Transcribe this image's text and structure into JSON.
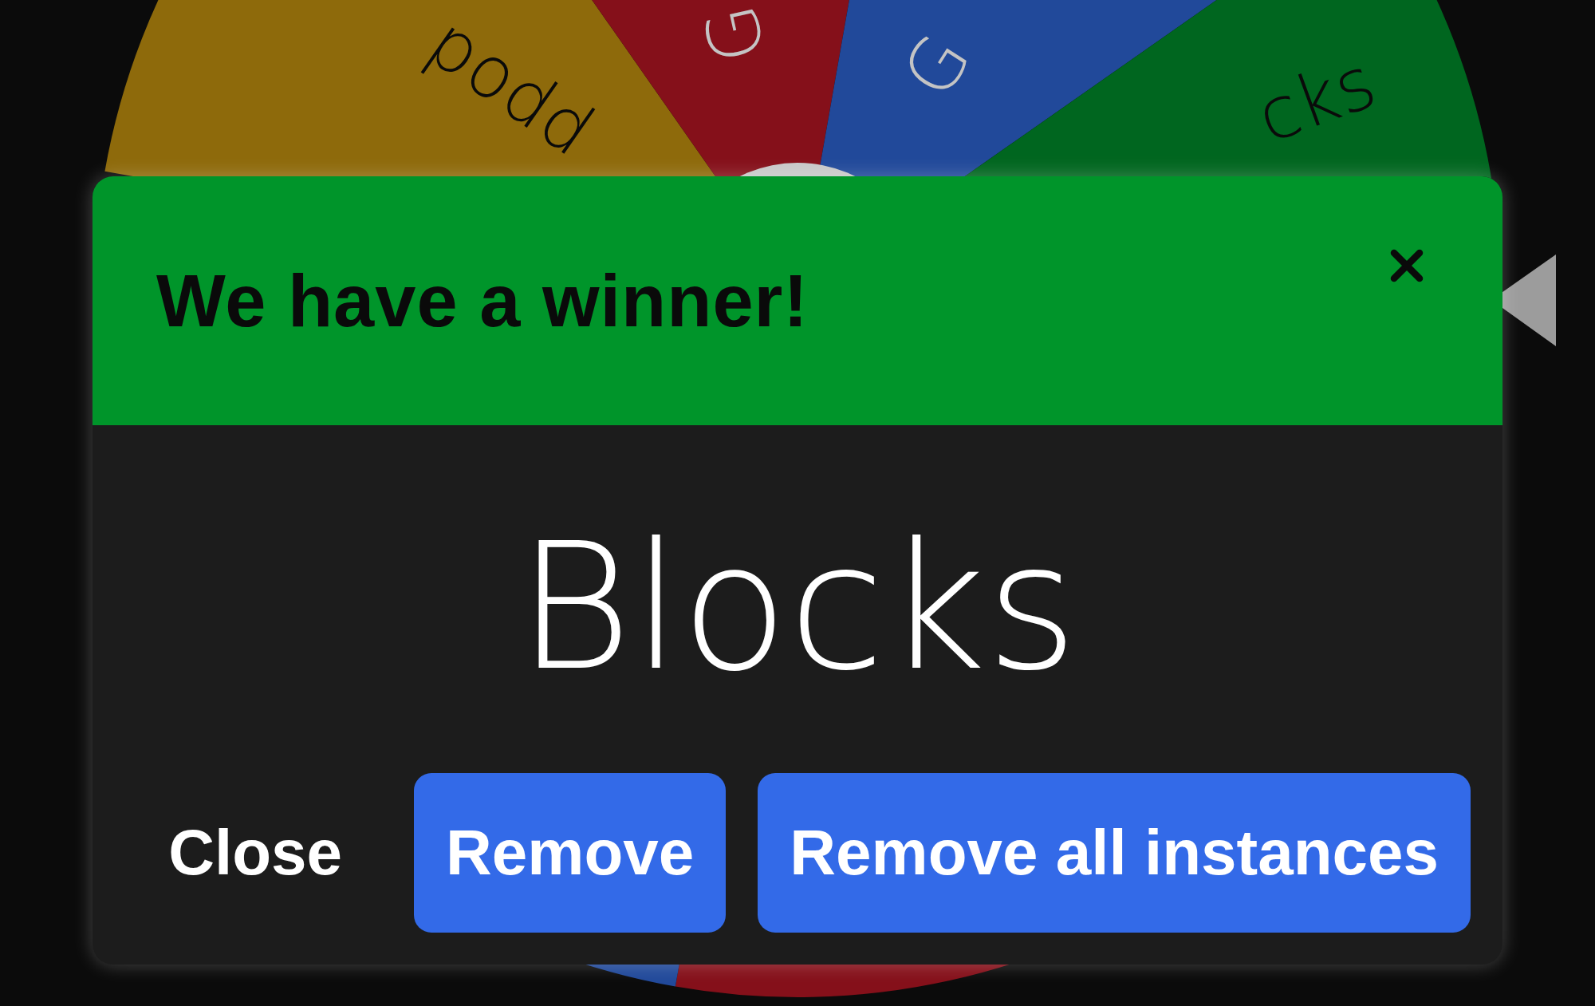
{
  "wheel": {
    "segments": [
      {
        "color": "#8e6a0b",
        "label": "ppod",
        "dark_label": true
      },
      {
        "color": "#85101a",
        "label": "G",
        "dark_label": false
      },
      {
        "color": "#21499a",
        "label": "G",
        "dark_label": false
      },
      {
        "color": "#00661f",
        "label": "cks",
        "dark_label": true
      },
      {
        "color": "#85101a"
      },
      {
        "color": "#21499a"
      }
    ]
  },
  "dialog": {
    "title": "We have a winner!",
    "winner": "Blocks",
    "buttons": [
      {
        "label": "Close",
        "kind": "text"
      },
      {
        "label": "Remove",
        "kind": "filled"
      },
      {
        "label": "Remove all instances",
        "kind": "filled"
      }
    ]
  }
}
